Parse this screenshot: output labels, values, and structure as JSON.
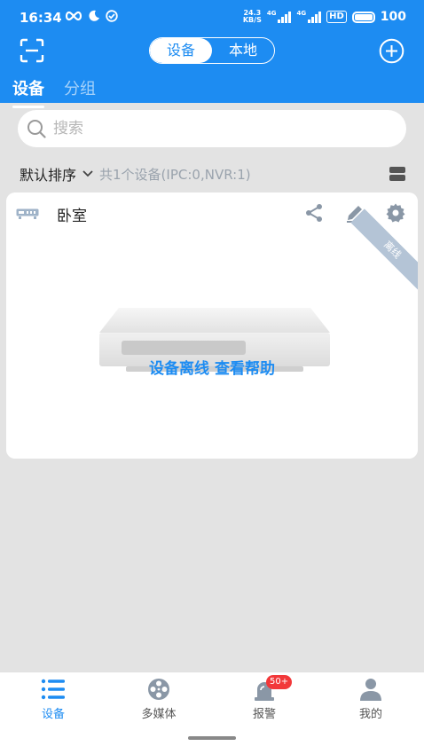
{
  "status_bar": {
    "time": "16:34",
    "net_speed_value": "24.3",
    "net_speed_unit": "KB/S",
    "network_1": "4G",
    "network_2": "4G",
    "hd": "HD",
    "battery": "100"
  },
  "header": {
    "segment_devices": "设备",
    "segment_local": "本地",
    "tabs": [
      {
        "label": "设备",
        "active": true
      },
      {
        "label": "分组",
        "active": false
      }
    ]
  },
  "search": {
    "placeholder": "搜索"
  },
  "sort": {
    "label": "默认排序",
    "device_count": "共1个设备(IPC:0,NVR:1)"
  },
  "device_card": {
    "name": "卧室",
    "status_ribbon": "离线",
    "offline_message": "设备离线 查看帮助",
    "actions": [
      "share-icon",
      "edit-icon",
      "settings-icon"
    ]
  },
  "bottom_nav": [
    {
      "label": "设备",
      "icon": "list-icon",
      "active": true
    },
    {
      "label": "多媒体",
      "icon": "film-reel-icon",
      "active": false
    },
    {
      "label": "报警",
      "icon": "alarm-light-icon",
      "active": false,
      "badge": "50+"
    },
    {
      "label": "我的",
      "icon": "user-icon",
      "active": false
    }
  ],
  "colors": {
    "primary": "#1d8cf2",
    "background": "#e3e3e3",
    "ribbon": "#b4c4d6",
    "badge": "#f2383a"
  }
}
